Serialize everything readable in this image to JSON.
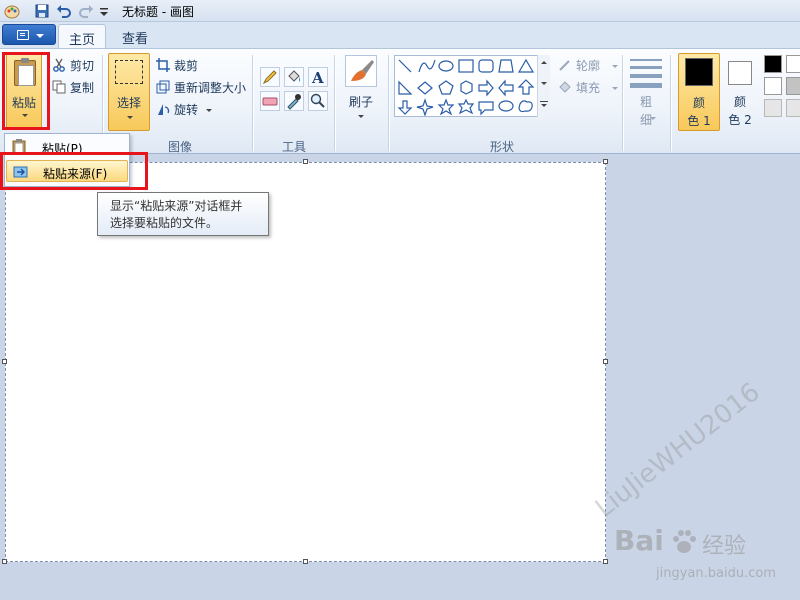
{
  "window": {
    "title": "无标题 - 画图"
  },
  "tabs": [
    {
      "label": "主页",
      "active": true
    },
    {
      "label": "查看",
      "active": false
    }
  ],
  "ribbon": {
    "clipboard": {
      "paste_label": "粘贴",
      "cut_label": "剪切",
      "copy_label": "复制"
    },
    "image": {
      "group_label": "图像",
      "select_label": "选择",
      "crop_label": "裁剪",
      "resize_label": "重新调整大小",
      "rotate_label": "旋转"
    },
    "tools": {
      "group_label": "工具"
    },
    "brushes": {
      "label": "刷子"
    },
    "shapes": {
      "group_label": "形状",
      "outline_label": "轮廓",
      "fill_label": "填充"
    },
    "size": {
      "label_line1": "粗",
      "label_line2": "细"
    },
    "colors": {
      "color1_line1": "颜",
      "color1_line2": "色 1",
      "color2_line1": "颜",
      "color2_line2": "色 2",
      "color1_value": "#000000",
      "color2_value": "#ffffff",
      "palette": [
        "#000000",
        "#ffffff",
        "#7f7f7f",
        "#c3c3c3",
        "#d9d9d9",
        "#ffffff"
      ]
    }
  },
  "paste_menu": {
    "items": [
      {
        "label": "粘贴(P)",
        "highlighted": false
      },
      {
        "label": "粘贴来源(F)",
        "highlighted": true
      }
    ]
  },
  "tooltip": {
    "line1": "显示“粘贴来源”对话框并",
    "line2": "选择要粘贴的文件。"
  },
  "watermark": {
    "brand": "Bai",
    "brand2": "经验",
    "url": "jingyan.baidu.com",
    "diagonal": "LiuJieWHU2016"
  },
  "accent_colors": {
    "highlight_red": "#e8141c",
    "hover_gold": "#f8c95a"
  }
}
